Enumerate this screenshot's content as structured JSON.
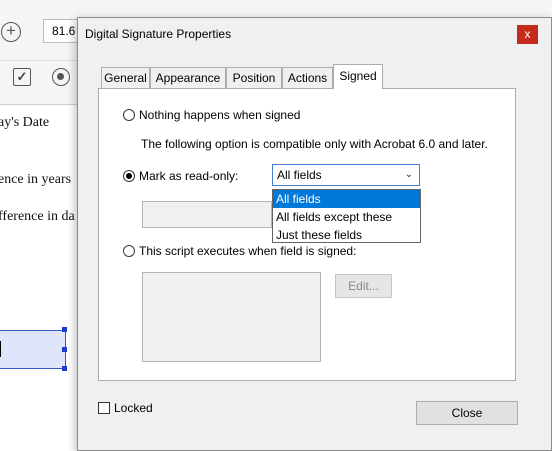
{
  "background": {
    "zoom_value": "81.6",
    "tool_check_icon": "checkbox-tool-icon",
    "tool_radio_icon": "radio-tool-icon",
    "text_lines": [
      "ay's Date",
      "ence in years",
      "fference in da"
    ],
    "field_selection_color": "#dfe6fb"
  },
  "dialog": {
    "title": "Digital Signature Properties",
    "close_glyph": "x",
    "tabs": [
      {
        "label": "General"
      },
      {
        "label": "Appearance"
      },
      {
        "label": "Position"
      },
      {
        "label": "Actions"
      },
      {
        "label": "Signed",
        "active": true
      }
    ],
    "options": {
      "nothing": "Nothing happens when signed",
      "compat_note": "The following option is compatible only with Acrobat 6.0 and later.",
      "mark_readonly": "Mark as read-only:",
      "script": "This script executes when field is signed:"
    },
    "selected_option": "mark_readonly",
    "readonly_select": {
      "value": "All fields",
      "items": [
        "All fields",
        "All fields except these",
        "Just these fields"
      ],
      "highlighted": "All fields"
    },
    "edit_button": "Edit...",
    "locked_label": "Locked",
    "locked_checked": false,
    "close_button": "Close",
    "colors": {
      "close_red": "#c42b1c",
      "selection_blue": "#0078d7"
    }
  }
}
